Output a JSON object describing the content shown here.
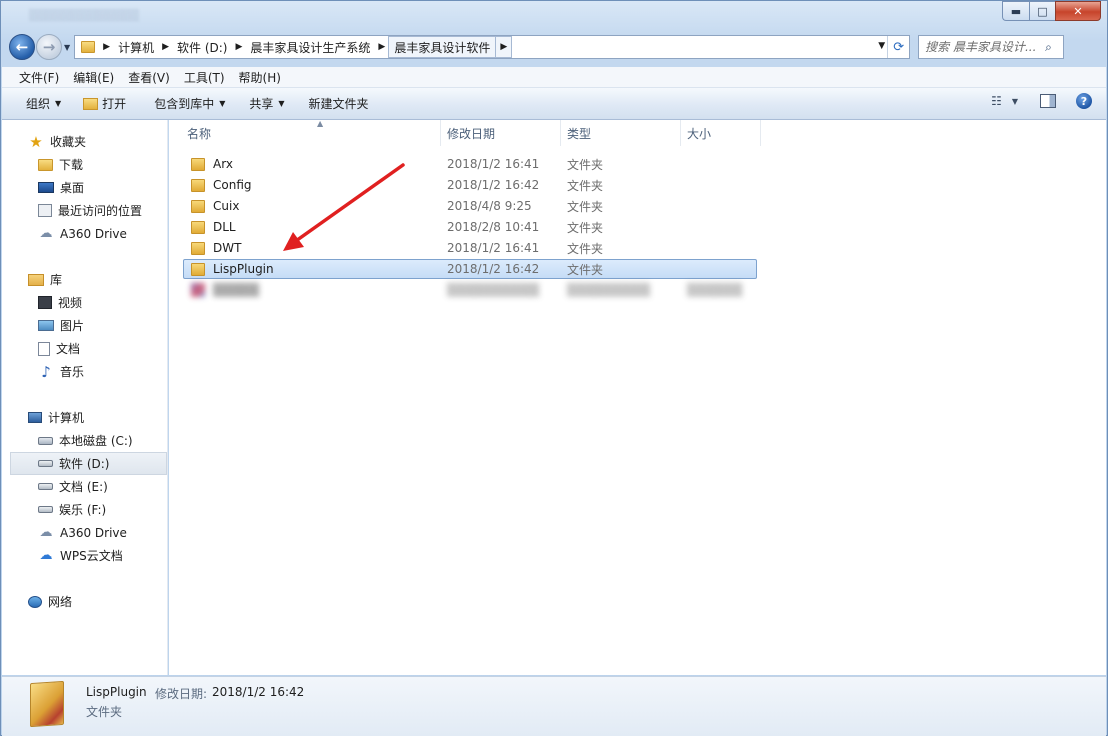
{
  "window": {
    "controls": {
      "minimize": "▬",
      "maximize": "□",
      "close": "✕"
    }
  },
  "address": {
    "segments": [
      "计算机",
      "软件 (D:)",
      "晨丰家具设计生产系统",
      "晨丰家具设计软件"
    ],
    "search_placeholder": "搜索 晨丰家具设计..."
  },
  "menu": [
    "文件(F)",
    "编辑(E)",
    "查看(V)",
    "工具(T)",
    "帮助(H)"
  ],
  "toolbar": {
    "organize": "组织",
    "open": "打开",
    "include_library": "包含到库中",
    "share": "共享",
    "new_folder": "新建文件夹"
  },
  "sidebar": {
    "favorites": {
      "label": "收藏夹",
      "items": [
        "下载",
        "桌面",
        "最近访问的位置",
        "A360 Drive"
      ]
    },
    "libraries": {
      "label": "库",
      "items": [
        "视频",
        "图片",
        "文档",
        "音乐"
      ]
    },
    "computer": {
      "label": "计算机",
      "items": [
        "本地磁盘 (C:)",
        "软件 (D:)",
        "文档 (E:)",
        "娱乐 (F:)",
        "A360 Drive",
        "WPS云文档"
      ]
    },
    "network": {
      "label": "网络"
    }
  },
  "columns": {
    "name": "名称",
    "date": "修改日期",
    "type": "类型",
    "size": "大小"
  },
  "files": [
    {
      "name": "Arx",
      "date": "2018/1/2 16:41",
      "type": "文件夹",
      "size": ""
    },
    {
      "name": "Config",
      "date": "2018/1/2 16:42",
      "type": "文件夹",
      "size": ""
    },
    {
      "name": "Cuix",
      "date": "2018/4/8 9:25",
      "type": "文件夹",
      "size": ""
    },
    {
      "name": "DLL",
      "date": "2018/2/8 10:41",
      "type": "文件夹",
      "size": ""
    },
    {
      "name": "DWT",
      "date": "2018/1/2 16:41",
      "type": "文件夹",
      "size": ""
    },
    {
      "name": "LispPlugin",
      "date": "2018/1/2 16:42",
      "type": "文件夹",
      "size": ""
    }
  ],
  "details": {
    "name": "LispPlugin",
    "modified_label": "修改日期:",
    "modified_value": "2018/1/2 16:42",
    "type": "文件夹"
  },
  "colors": {
    "annotation_arrow": "#e02020",
    "selection": "#cde3fb"
  }
}
